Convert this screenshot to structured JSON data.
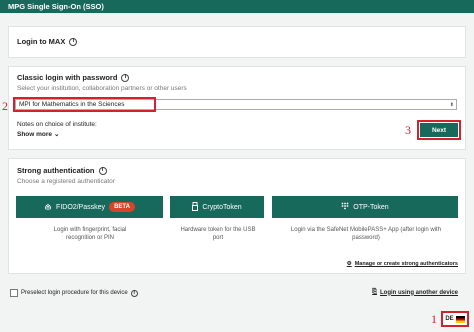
{
  "header": {
    "title": "MPG Single Sign-On (SSO)"
  },
  "login_max": {
    "title": "Login to MAX",
    "info_icon": "info-icon"
  },
  "classic": {
    "title": "Classic login with password",
    "subtitle": "Select your institution, collaboration partners or other users",
    "institution_value": "MPI for Mathematics in the Sciences",
    "notes_label": "Notes on choice of institute:",
    "show_more_label": "Show more",
    "next_label": "Next"
  },
  "strong": {
    "title": "Strong authentication",
    "subtitle": "Choose a registered authenticator",
    "options": [
      {
        "label": "FIDO2/Passkey",
        "badge": "BETA",
        "icon": "fingerprint-icon",
        "desc": "Login with fingerprint, facial recognition or PIN"
      },
      {
        "label": "CryptoToken",
        "icon": "usb-token-icon",
        "desc": "Hardware token for the USB port"
      },
      {
        "label": "OTP-Token",
        "icon": "keypad-icon",
        "desc": "Login via the SafeNet MobilePASS+ App (after login with password)"
      }
    ],
    "manage_label": "Manage or create strong authenticators"
  },
  "footer": {
    "preselect_label": "Preselect login procedure for this device",
    "other_device_label": "Login using another device",
    "lang_code": "DE"
  },
  "annotations": {
    "n1": "1",
    "n2": "2",
    "n3": "3"
  },
  "colors": {
    "brand": "#17695c",
    "annotation": "#d3212d",
    "beta": "#d6452b"
  }
}
